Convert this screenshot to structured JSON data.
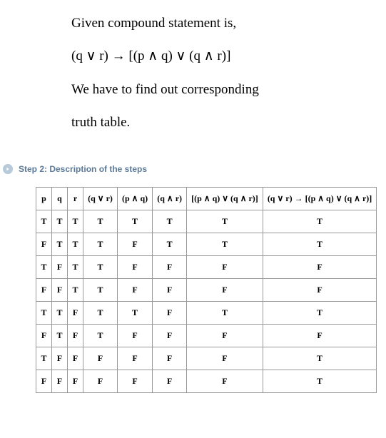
{
  "intro": {
    "line1": "Given compound statement is,",
    "line2": "(q ∨ r) → [(p ∧ q) ∨ (q ∧ r)]",
    "line3": "We have to find out corresponding",
    "line4": "truth table."
  },
  "step": {
    "label": "Step 2: Description of the steps"
  },
  "table": {
    "headers": [
      "p",
      "q",
      "r",
      "(q ∨ r)",
      "(p ∧ q)",
      "(q ∧ r)",
      "[(p ∧ q) ∨ (q ∧ r)]",
      "(q ∨ r) → [(p ∧ q) ∨ (q ∧ r)]"
    ],
    "rows": [
      [
        "T",
        "T",
        "T",
        "T",
        "T",
        "T",
        "T",
        "T"
      ],
      [
        "F",
        "T",
        "T",
        "T",
        "F",
        "T",
        "T",
        "T"
      ],
      [
        "T",
        "F",
        "T",
        "T",
        "F",
        "F",
        "F",
        "F"
      ],
      [
        "F",
        "F",
        "T",
        "T",
        "F",
        "F",
        "F",
        "F"
      ],
      [
        "T",
        "T",
        "F",
        "T",
        "T",
        "F",
        "T",
        "T"
      ],
      [
        "F",
        "T",
        "F",
        "T",
        "F",
        "F",
        "F",
        "F"
      ],
      [
        "T",
        "F",
        "F",
        "F",
        "F",
        "F",
        "F",
        "T"
      ],
      [
        "F",
        "F",
        "F",
        "F",
        "F",
        "F",
        "F",
        "T"
      ]
    ]
  }
}
